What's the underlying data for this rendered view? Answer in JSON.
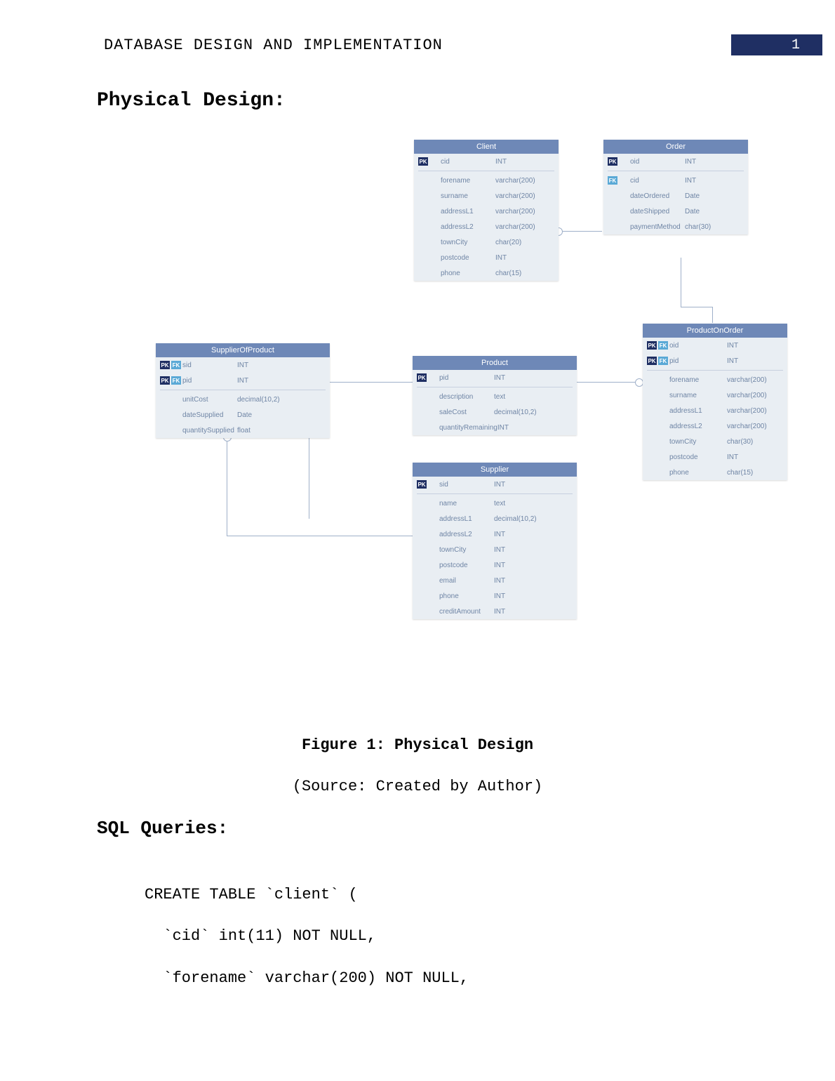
{
  "header": {
    "title": "DATABASE DESIGN AND IMPLEMENTATION",
    "page_number": "1"
  },
  "sections": {
    "physical_design": "Physical Design:",
    "sql_queries": "SQL Queries:"
  },
  "figure": {
    "caption": "Figure 1: Physical Design",
    "source": "(Source: Created by Author)"
  },
  "erd": {
    "client": {
      "title": "Client",
      "rows": [
        {
          "pk": true,
          "fk": false,
          "name": "cid",
          "type": "INT"
        },
        {
          "pk": false,
          "fk": false,
          "name": "forename",
          "type": "varchar(200)"
        },
        {
          "pk": false,
          "fk": false,
          "name": "surname",
          "type": "varchar(200)"
        },
        {
          "pk": false,
          "fk": false,
          "name": "addressL1",
          "type": "varchar(200)"
        },
        {
          "pk": false,
          "fk": false,
          "name": "addressL2",
          "type": "varchar(200)"
        },
        {
          "pk": false,
          "fk": false,
          "name": "townCity",
          "type": "char(20)"
        },
        {
          "pk": false,
          "fk": false,
          "name": "postcode",
          "type": "INT"
        },
        {
          "pk": false,
          "fk": false,
          "name": "phone",
          "type": "char(15)"
        }
      ]
    },
    "order": {
      "title": "Order",
      "rows": [
        {
          "pk": true,
          "fk": false,
          "name": "oid",
          "type": "INT"
        },
        {
          "pk": false,
          "fk": true,
          "name": "cid",
          "type": "INT"
        },
        {
          "pk": false,
          "fk": false,
          "name": "dateOrdered",
          "type": "Date"
        },
        {
          "pk": false,
          "fk": false,
          "name": "dateShipped",
          "type": "Date"
        },
        {
          "pk": false,
          "fk": false,
          "name": "paymentMethod",
          "type": "char(30)"
        }
      ]
    },
    "supplierOfProduct": {
      "title": "SupplierOfProduct",
      "rows": [
        {
          "pk": true,
          "fk": true,
          "name": "sid",
          "type": "INT"
        },
        {
          "pk": true,
          "fk": true,
          "name": "pid",
          "type": "INT"
        },
        {
          "pk": false,
          "fk": false,
          "name": "unitCost",
          "type": "decimal(10,2)"
        },
        {
          "pk": false,
          "fk": false,
          "name": "dateSupplied",
          "type": "Date"
        },
        {
          "pk": false,
          "fk": false,
          "name": "quantitySupplied",
          "type": "float"
        }
      ]
    },
    "product": {
      "title": "Product",
      "rows": [
        {
          "pk": true,
          "fk": false,
          "name": "pid",
          "type": "INT"
        },
        {
          "pk": false,
          "fk": false,
          "name": "description",
          "type": "text"
        },
        {
          "pk": false,
          "fk": false,
          "name": "saleCost",
          "type": "decimal(10,2)"
        },
        {
          "pk": false,
          "fk": false,
          "name": "quantityRemaining",
          "type": "INT"
        }
      ]
    },
    "productOnOrder": {
      "title": "ProductOnOrder",
      "rows": [
        {
          "pk": true,
          "fk": true,
          "name": "oid",
          "type": "INT"
        },
        {
          "pk": true,
          "fk": true,
          "name": "pid",
          "type": "INT"
        },
        {
          "pk": false,
          "fk": false,
          "name": "forename",
          "type": "varchar(200)"
        },
        {
          "pk": false,
          "fk": false,
          "name": "surname",
          "type": "varchar(200)"
        },
        {
          "pk": false,
          "fk": false,
          "name": "addressL1",
          "type": "varchar(200)"
        },
        {
          "pk": false,
          "fk": false,
          "name": "addressL2",
          "type": "varchar(200)"
        },
        {
          "pk": false,
          "fk": false,
          "name": "townCity",
          "type": "char(30)"
        },
        {
          "pk": false,
          "fk": false,
          "name": "postcode",
          "type": "INT"
        },
        {
          "pk": false,
          "fk": false,
          "name": "phone",
          "type": "char(15)"
        }
      ]
    },
    "supplier": {
      "title": "Supplier",
      "rows": [
        {
          "pk": true,
          "fk": false,
          "name": "sid",
          "type": "INT"
        },
        {
          "pk": false,
          "fk": false,
          "name": "name",
          "type": "text"
        },
        {
          "pk": false,
          "fk": false,
          "name": "addressL1",
          "type": "decimal(10,2)"
        },
        {
          "pk": false,
          "fk": false,
          "name": "addressL2",
          "type": "INT"
        },
        {
          "pk": false,
          "fk": false,
          "name": "townCity",
          "type": "INT"
        },
        {
          "pk": false,
          "fk": false,
          "name": "postcode",
          "type": "INT"
        },
        {
          "pk": false,
          "fk": false,
          "name": "email",
          "type": "INT"
        },
        {
          "pk": false,
          "fk": false,
          "name": "phone",
          "type": "INT"
        },
        {
          "pk": false,
          "fk": false,
          "name": "creditAmount",
          "type": "INT"
        }
      ]
    }
  },
  "sql": {
    "line1": "CREATE TABLE `client` (",
    "line2": "  `cid` int(11) NOT NULL,",
    "line3": "  `forename` varchar(200) NOT NULL,"
  }
}
